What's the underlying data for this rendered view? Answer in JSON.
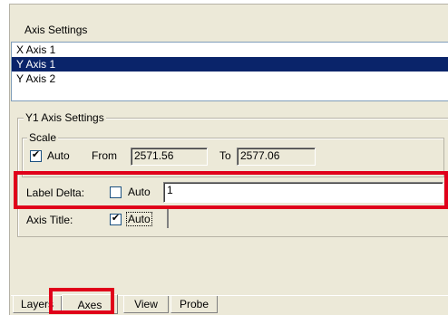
{
  "panel": {
    "title": "Axis Settings",
    "axes_list": [
      "X Axis 1",
      "Y Axis 1",
      "Y Axis 2"
    ],
    "selected_index": 1
  },
  "y1_settings": {
    "group_title": "Y1 Axis Settings",
    "scale": {
      "group_title": "Scale",
      "auto_label": "Auto",
      "auto_checked": true,
      "from_label": "From",
      "from_value": "2571.56",
      "to_label": "To",
      "to_value": "2577.06"
    },
    "label_delta": {
      "label": "Label Delta:",
      "auto_label": "Auto",
      "auto_checked": false,
      "value": "1"
    },
    "axis_title": {
      "label": "Axis Title:",
      "auto_label": "Auto",
      "auto_checked": true
    }
  },
  "tabs": [
    "Layers",
    "Axes",
    "View",
    "Probe"
  ],
  "active_tab": "Axes",
  "colors": {
    "highlight": "#e0001a",
    "selection": "#0a246a",
    "dialog_bg": "#ece9d8"
  }
}
